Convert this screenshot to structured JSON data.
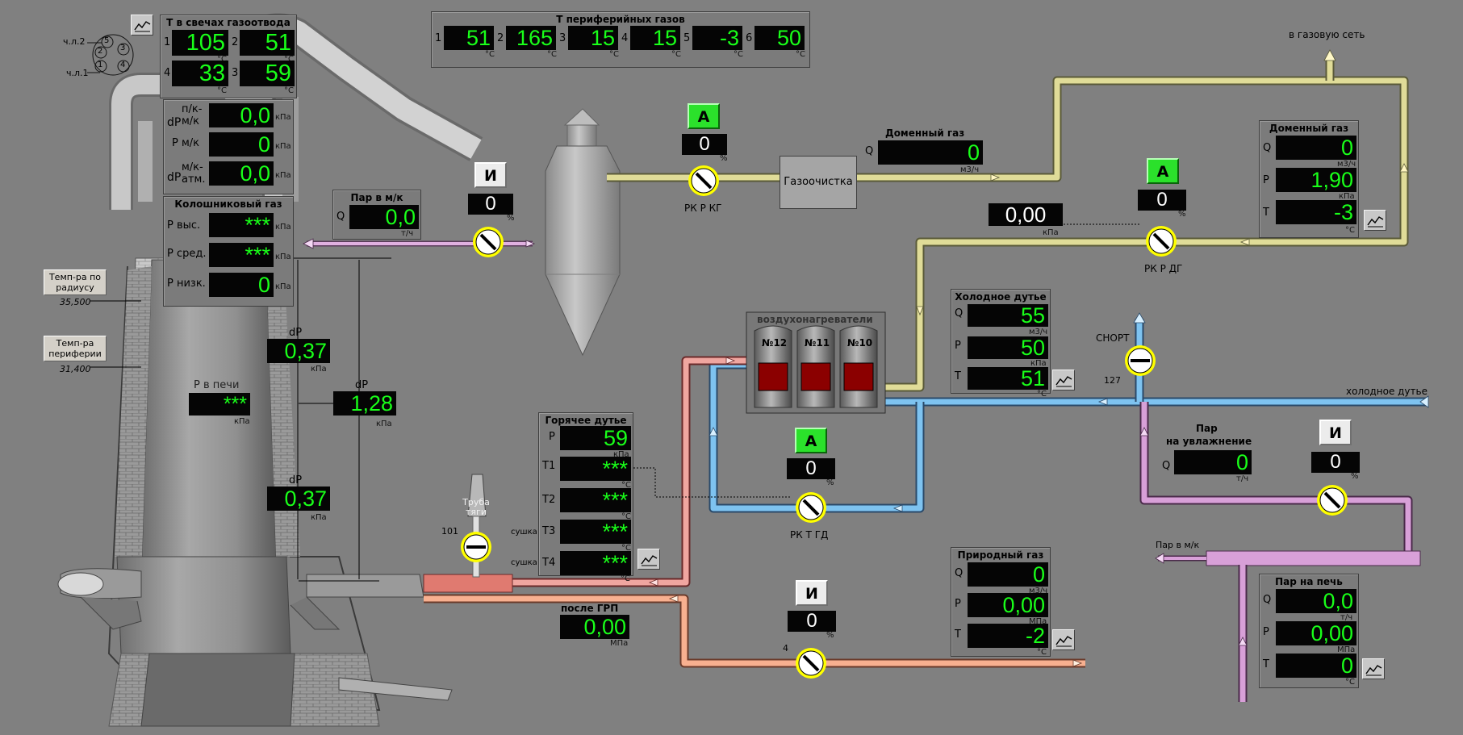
{
  "colors": {
    "background": "#808080",
    "display_bg": "#050505",
    "display_text": "#19ff19",
    "mode_auto": "#2be12b",
    "mode_manual": "#ececec",
    "pipe_blast_gas": "#e0dc98",
    "pipe_cold_blast": "#7ec3f0",
    "pipe_hot_blast": "#f0a6a0",
    "pipe_natural_gas": "#f8b090",
    "pipe_steam": "#d8a0d8",
    "valve_ring": "#ffff00",
    "stove_window": "#8b0000"
  },
  "icons": {
    "trend": "trend-chart-icon",
    "valve": "butterfly-valve-icon",
    "arrow": "flow-arrow-icon"
  },
  "candles": {
    "title": "Т в свечах газоотвода",
    "values": [
      "105",
      "51",
      "33",
      "59"
    ],
    "indices": [
      "1",
      "2",
      "4",
      "3"
    ],
    "unit": "°С"
  },
  "candle_scheme": {
    "l2": "ч.л.2",
    "l1": "ч.л.1",
    "n": [
      "1",
      "2",
      "3",
      "4",
      "5"
    ]
  },
  "pressure_drops": {
    "dp_pk_mk_label_1": "dP",
    "dp_pk_mk_label_2": "п/к-",
    "dp_pk_mk_label_3": "м/к",
    "dp_pk_mk": "0,0",
    "p_mk_label": "Р м/к",
    "p_mk": "0",
    "dp_mk_atm_label_1": "dP",
    "dp_mk_atm_label_2": "м/к-",
    "dp_mk_atm_label_3": "атм.",
    "dp_mk_atm": "0,0",
    "unit": "кПа"
  },
  "top_gas": {
    "title": "Колошниковый газ",
    "p_high_label": "Р выс.",
    "p_high": "***",
    "p_mid_label": "Р сред.",
    "p_mid": "***",
    "p_low_label": "Р низк.",
    "p_low": "0",
    "unit": "кПа"
  },
  "temp_buttons": {
    "radius_label": "Темп-ра по радиусу",
    "radius_value": "35,500",
    "periphery_label": "Темп-ра периферии",
    "periphery_value": "31,400"
  },
  "furnace": {
    "dp_upper_label": "dP",
    "dp_upper": "0,37",
    "dp_total_label": "dP",
    "dp_total": "1,28",
    "dp_lower_label": "dP",
    "dp_lower": "0,37",
    "p_furnace_label": "Р в печи",
    "p_furnace": "***",
    "unit": "кПа"
  },
  "steam_to_mk_panel": {
    "title": "Пар в м/к",
    "q_label": "Q",
    "q_value": "0,0",
    "unit": "т/ч"
  },
  "steam_mk_valve": {
    "mode": "И",
    "position": "0",
    "unit": "%"
  },
  "peripheral_gases": {
    "title": "Т периферийных газов",
    "indices": [
      "1",
      "2",
      "3",
      "4",
      "5",
      "6"
    ],
    "values": [
      "51",
      "165",
      "15",
      "15",
      "-3",
      "50"
    ],
    "unit": "°С"
  },
  "rk_r_kg": {
    "mode": "А",
    "position": "0",
    "unit": "%",
    "label": "РК Р КГ"
  },
  "gas_cleaning": {
    "label": "Газоочистка"
  },
  "blast_gas_flow": {
    "title": "Доменный газ",
    "q_label": "Q",
    "q_value": "0",
    "unit": "м3/ч"
  },
  "gas_network_label": "в газовую сеть",
  "blast_gas_panel": {
    "title": "Доменный газ",
    "q_label": "Q",
    "q_value": "0",
    "q_unit": "м3/ч",
    "p_label": "Р",
    "p_value": "1,90",
    "p_unit": "кПа",
    "t_label": "Т",
    "t_value": "-3",
    "t_unit": "°С"
  },
  "rk_r_dg": {
    "mode": "А",
    "position": "0",
    "unit": "%",
    "label": "РК Р ДГ",
    "setpoint": "0,00",
    "setpoint_unit": "кПа"
  },
  "stoves": {
    "title": "воздухонагреватели",
    "items": [
      "№12",
      "№11",
      "№10"
    ]
  },
  "cold_blast": {
    "title": "Холодное дутье",
    "q_label": "Q",
    "q_value": "55",
    "q_unit": "м3/ч",
    "p_label": "Р",
    "p_value": "50",
    "p_unit": "кПа",
    "t_label": "Т",
    "t_value": "51",
    "t_unit": "°С",
    "line_label": "холодное дутье"
  },
  "snort": {
    "label": "СНОРТ",
    "number": "127"
  },
  "hot_blast": {
    "title": "Горячее дутье",
    "p_label": "Р",
    "p_value": "59",
    "p_unit": "кПа",
    "t1_label": "Т1",
    "t1_value": "***",
    "t2_label": "Т2",
    "t2_value": "***",
    "t3_label": "Т3",
    "t3_value": "***",
    "t4_label": "Т4",
    "t4_value": "***",
    "t_unit": "°С",
    "drying_label": "сушка"
  },
  "rk_t_gd": {
    "mode": "А",
    "position": "0",
    "unit": "%",
    "label": "РК Т ГД"
  },
  "draft_pipe": {
    "label": "Труба тяги",
    "number": "101"
  },
  "after_grp": {
    "title": "после ГРП",
    "value": "0,00",
    "unit": "МПа"
  },
  "natural_gas_valve": {
    "mode": "И",
    "position": "0",
    "unit": "%",
    "number": "4"
  },
  "natural_gas": {
    "title": "Природный газ",
    "q_label": "Q",
    "q_value": "0",
    "q_unit": "м3/ч",
    "p_label": "Р",
    "p_value": "0,00",
    "p_unit": "МПа",
    "t_label": "Т",
    "t_value": "-2",
    "t_unit": "°С"
  },
  "humidification_steam": {
    "title_1": "Пар",
    "title_2": "на увлажнение",
    "q_label": "Q",
    "q_value": "0",
    "unit": "т/ч"
  },
  "humidification_valve": {
    "mode": "И",
    "position": "0",
    "unit": "%"
  },
  "steam_mk_line_label": "Пар в м/к",
  "furnace_steam": {
    "title": "Пар на печь",
    "q_label": "Q",
    "q_value": "0,0",
    "q_unit": "т/ч",
    "p_label": "Р",
    "p_value": "0,00",
    "p_unit": "МПа",
    "t_label": "Т",
    "t_value": "0",
    "t_unit": "°С"
  }
}
